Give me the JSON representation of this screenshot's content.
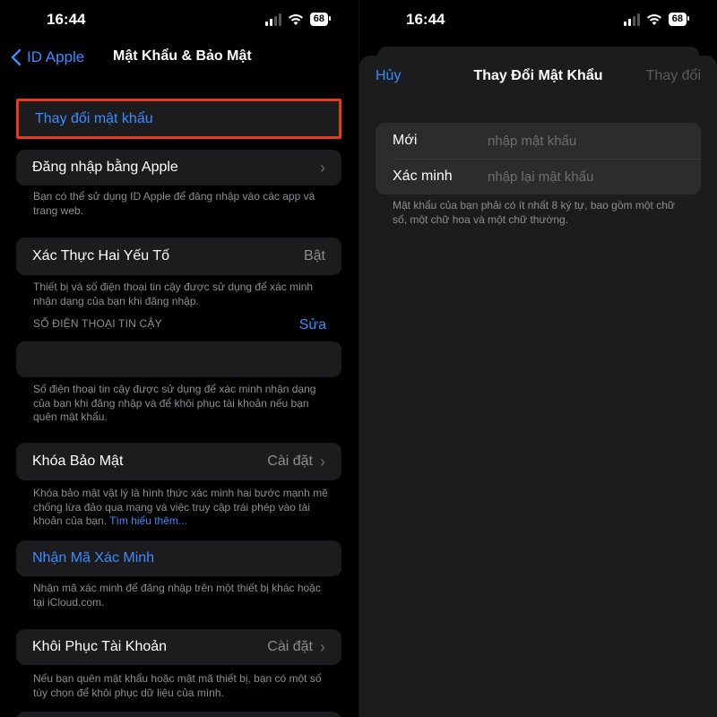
{
  "status": {
    "time": "16:44",
    "battery": "68"
  },
  "left": {
    "back_label": "ID Apple",
    "title": "Mật Khẩu & Bảo Mật",
    "change_password": "Thay đổi mật khẩu",
    "sign_in_apple": "Đăng nhập bằng Apple",
    "sign_in_note": "Bạn có thể sử dụng ID Apple để đăng nhập vào các app và trang web.",
    "two_factor": {
      "label": "Xác Thực Hai Yếu Tố",
      "value": "Bật"
    },
    "two_factor_note": "Thiết bị và số điện thoại tin cậy được sử dụng để xác minh nhận dạng của bạn khi đăng nhập.",
    "trusted_header": "SỐ ĐIỆN THOẠI TIN CẬY",
    "edit": "Sửa",
    "trusted_note": "Số điện thoại tin cậy được sử dụng để xác minh nhận dạng của bạn khi đăng nhập và để khôi phục tài khoản nếu bạn quên mật khẩu.",
    "security_key": {
      "label": "Khóa Bảo Mật",
      "value": "Cài đặt"
    },
    "security_key_note": "Khóa bảo mật vật lý là hình thức xác minh hai bước mạnh mẽ chống lừa đảo qua mạng và việc truy cập trái phép vào tài khoản của bạn.",
    "learn_more": "Tìm hiểu thêm...",
    "get_code": "Nhận Mã Xác Minh",
    "get_code_note": "Nhận mã xác minh để đăng nhập trên một thiết bị khác hoặc tại iCloud.com.",
    "recovery": {
      "label": "Khôi Phục Tài Khoản",
      "value": "Cài đặt"
    },
    "recovery_note": "Nếu bạn quên mật khẩu hoặc mật mã thiết bị, bạn có một số tùy chọn để khôi phục dữ liệu của mình."
  },
  "right": {
    "cancel": "Hủy",
    "title": "Thay Đổi Mật Khẩu",
    "done": "Thay đổi",
    "new_label": "Mới",
    "new_placeholder": "nhập mật khẩu",
    "verify_label": "Xác minh",
    "verify_placeholder": "nhập lại mật khẩu",
    "note": "Mật khẩu của bạn phải có ít nhất 8 ký tự, bao gồm một chữ số, một chữ hoa và một chữ thường."
  },
  "colors": {
    "accent": "#3b8cff",
    "highlight": "#e53a1e",
    "cell": "#1c1c1e"
  }
}
